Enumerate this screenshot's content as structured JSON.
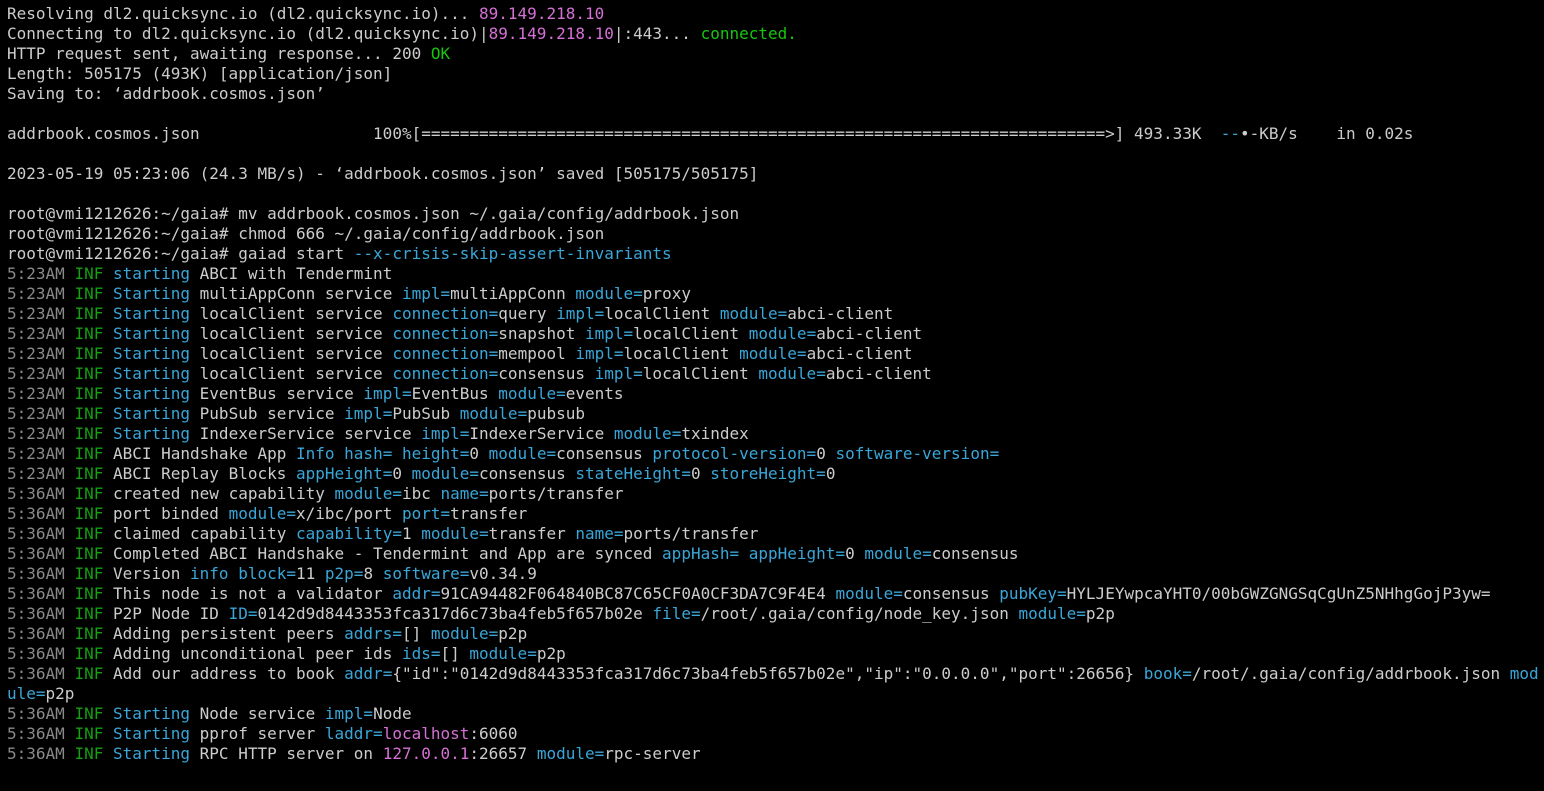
{
  "colors": {
    "default": "#cccccc",
    "cyan": "#3aa6d8",
    "green": "#13a10e",
    "bright-green": "#16c60c",
    "magenta": "#d670d6",
    "gray": "#8a8a8a",
    "blue-dim": "#3b78ff",
    "background": "#000000"
  },
  "lines": [
    {
      "segs": [
        [
          "default",
          "Resolving dl2.quicksync.io (dl2.quicksync.io)... "
        ],
        [
          "magenta",
          "89.149.218.10"
        ]
      ]
    },
    {
      "segs": [
        [
          "default",
          "Connecting to dl2.quicksync.io (dl2.quicksync.io)|"
        ],
        [
          "magenta",
          "89.149.218.10"
        ],
        [
          "default",
          "|:443... "
        ],
        [
          "bright-green",
          "connected."
        ]
      ]
    },
    {
      "segs": [
        [
          "default",
          "HTTP request sent, awaiting response... 200 "
        ],
        [
          "bright-green",
          "OK"
        ]
      ]
    },
    {
      "segs": [
        [
          "default",
          "Length: 505175 (493K) [application/json]"
        ]
      ]
    },
    {
      "segs": [
        [
          "default",
          "Saving to: ‘addrbook.cosmos.json’"
        ]
      ]
    },
    {
      "segs": [
        [
          "default",
          ""
        ]
      ]
    },
    {
      "segs": [
        [
          "default",
          "addrbook.cosmos.json                  100%[=======================================================================>] 493.33K  "
        ],
        [
          "cyan",
          "--"
        ],
        [
          "default",
          "•-KB/s    in 0.02s"
        ]
      ]
    },
    {
      "segs": [
        [
          "default",
          ""
        ]
      ]
    },
    {
      "segs": [
        [
          "default",
          "2023-05-19 05:23:06 (24.3 MB/s) - ‘addrbook.cosmos.json’ saved [505175/505175]"
        ]
      ]
    },
    {
      "segs": [
        [
          "default",
          ""
        ]
      ]
    },
    {
      "segs": [
        [
          "default",
          "root@vmi1212626:~/gaia# mv addrbook.cosmos.json ~/.gaia/config/addrbook.json"
        ]
      ]
    },
    {
      "segs": [
        [
          "default",
          "root@vmi1212626:~/gaia# chmod 666 ~/.gaia/config/addrbook.json"
        ]
      ]
    },
    {
      "segs": [
        [
          "default",
          "root@vmi1212626:~/gaia# gaiad start "
        ],
        [
          "cyan",
          "--x-crisis-skip-assert-invariants"
        ]
      ]
    },
    {
      "segs": [
        [
          "gray",
          "5:23AM "
        ],
        [
          "green",
          "INF "
        ],
        [
          "cyan",
          "starting"
        ],
        [
          "default",
          " ABCI with Tendermint"
        ]
      ]
    },
    {
      "segs": [
        [
          "gray",
          "5:23AM "
        ],
        [
          "green",
          "INF "
        ],
        [
          "cyan",
          "Starting"
        ],
        [
          "default",
          " multiAppConn service "
        ],
        [
          "cyan",
          "impl="
        ],
        [
          "default",
          "multiAppConn "
        ],
        [
          "cyan",
          "module="
        ],
        [
          "default",
          "proxy"
        ]
      ]
    },
    {
      "segs": [
        [
          "gray",
          "5:23AM "
        ],
        [
          "green",
          "INF "
        ],
        [
          "cyan",
          "Starting"
        ],
        [
          "default",
          " localClient service "
        ],
        [
          "cyan",
          "connection="
        ],
        [
          "default",
          "query "
        ],
        [
          "cyan",
          "impl="
        ],
        [
          "default",
          "localClient "
        ],
        [
          "cyan",
          "module="
        ],
        [
          "default",
          "abci-client"
        ]
      ]
    },
    {
      "segs": [
        [
          "gray",
          "5:23AM "
        ],
        [
          "green",
          "INF "
        ],
        [
          "cyan",
          "Starting"
        ],
        [
          "default",
          " localClient service "
        ],
        [
          "cyan",
          "connection="
        ],
        [
          "default",
          "snapshot "
        ],
        [
          "cyan",
          "impl="
        ],
        [
          "default",
          "localClient "
        ],
        [
          "cyan",
          "module="
        ],
        [
          "default",
          "abci-client"
        ]
      ]
    },
    {
      "segs": [
        [
          "gray",
          "5:23AM "
        ],
        [
          "green",
          "INF "
        ],
        [
          "cyan",
          "Starting"
        ],
        [
          "default",
          " localClient service "
        ],
        [
          "cyan",
          "connection="
        ],
        [
          "default",
          "mempool "
        ],
        [
          "cyan",
          "impl="
        ],
        [
          "default",
          "localClient "
        ],
        [
          "cyan",
          "module="
        ],
        [
          "default",
          "abci-client"
        ]
      ]
    },
    {
      "segs": [
        [
          "gray",
          "5:23AM "
        ],
        [
          "green",
          "INF "
        ],
        [
          "cyan",
          "Starting"
        ],
        [
          "default",
          " localClient service "
        ],
        [
          "cyan",
          "connection="
        ],
        [
          "default",
          "consensus "
        ],
        [
          "cyan",
          "impl="
        ],
        [
          "default",
          "localClient "
        ],
        [
          "cyan",
          "module="
        ],
        [
          "default",
          "abci-client"
        ]
      ]
    },
    {
      "segs": [
        [
          "gray",
          "5:23AM "
        ],
        [
          "green",
          "INF "
        ],
        [
          "cyan",
          "Starting"
        ],
        [
          "default",
          " EventBus service "
        ],
        [
          "cyan",
          "impl="
        ],
        [
          "default",
          "EventBus "
        ],
        [
          "cyan",
          "module="
        ],
        [
          "default",
          "events"
        ]
      ]
    },
    {
      "segs": [
        [
          "gray",
          "5:23AM "
        ],
        [
          "green",
          "INF "
        ],
        [
          "cyan",
          "Starting"
        ],
        [
          "default",
          " PubSub service "
        ],
        [
          "cyan",
          "impl="
        ],
        [
          "default",
          "PubSub "
        ],
        [
          "cyan",
          "module="
        ],
        [
          "default",
          "pubsub"
        ]
      ]
    },
    {
      "segs": [
        [
          "gray",
          "5:23AM "
        ],
        [
          "green",
          "INF "
        ],
        [
          "cyan",
          "Starting"
        ],
        [
          "default",
          " IndexerService service "
        ],
        [
          "cyan",
          "impl="
        ],
        [
          "default",
          "IndexerService "
        ],
        [
          "cyan",
          "module="
        ],
        [
          "default",
          "txindex"
        ]
      ]
    },
    {
      "segs": [
        [
          "gray",
          "5:23AM "
        ],
        [
          "green",
          "INF "
        ],
        [
          "default",
          "ABCI Handshake App "
        ],
        [
          "cyan",
          "Info hash= height="
        ],
        [
          "default",
          "0 "
        ],
        [
          "cyan",
          "module="
        ],
        [
          "default",
          "consensus "
        ],
        [
          "cyan",
          "protocol-version="
        ],
        [
          "default",
          "0 "
        ],
        [
          "cyan",
          "software-version="
        ]
      ]
    },
    {
      "segs": [
        [
          "gray",
          "5:23AM "
        ],
        [
          "green",
          "INF "
        ],
        [
          "default",
          "ABCI Replay Blocks "
        ],
        [
          "cyan",
          "appHeight="
        ],
        [
          "default",
          "0 "
        ],
        [
          "cyan",
          "module="
        ],
        [
          "default",
          "consensus "
        ],
        [
          "cyan",
          "stateHeight="
        ],
        [
          "default",
          "0 "
        ],
        [
          "cyan",
          "storeHeight="
        ],
        [
          "default",
          "0"
        ]
      ]
    },
    {
      "segs": [
        [
          "gray",
          "5:36AM "
        ],
        [
          "green",
          "INF "
        ],
        [
          "default",
          "created new capability "
        ],
        [
          "cyan",
          "module="
        ],
        [
          "default",
          "ibc "
        ],
        [
          "cyan",
          "name="
        ],
        [
          "default",
          "ports/transfer"
        ]
      ]
    },
    {
      "segs": [
        [
          "gray",
          "5:36AM "
        ],
        [
          "green",
          "INF "
        ],
        [
          "default",
          "port binded "
        ],
        [
          "cyan",
          "module="
        ],
        [
          "default",
          "x/ibc/port "
        ],
        [
          "cyan",
          "port="
        ],
        [
          "default",
          "transfer"
        ]
      ]
    },
    {
      "segs": [
        [
          "gray",
          "5:36AM "
        ],
        [
          "green",
          "INF "
        ],
        [
          "default",
          "claimed capability "
        ],
        [
          "cyan",
          "capability="
        ],
        [
          "default",
          "1 "
        ],
        [
          "cyan",
          "module="
        ],
        [
          "default",
          "transfer "
        ],
        [
          "cyan",
          "name="
        ],
        [
          "default",
          "ports/transfer"
        ]
      ]
    },
    {
      "segs": [
        [
          "gray",
          "5:36AM "
        ],
        [
          "green",
          "INF "
        ],
        [
          "default",
          "Completed ABCI Handshake - Tendermint and App are synced "
        ],
        [
          "cyan",
          "appHash= appHeight="
        ],
        [
          "default",
          "0 "
        ],
        [
          "cyan",
          "module="
        ],
        [
          "default",
          "consensus"
        ]
      ]
    },
    {
      "segs": [
        [
          "gray",
          "5:36AM "
        ],
        [
          "green",
          "INF "
        ],
        [
          "default",
          "Version "
        ],
        [
          "cyan",
          "info block="
        ],
        [
          "default",
          "11 "
        ],
        [
          "cyan",
          "p2p="
        ],
        [
          "default",
          "8 "
        ],
        [
          "cyan",
          "software="
        ],
        [
          "default",
          "v0.34.9"
        ]
      ]
    },
    {
      "wrap": true,
      "segs": [
        [
          "gray",
          "5:36AM "
        ],
        [
          "green",
          "INF "
        ],
        [
          "default",
          "This node is not a validator "
        ],
        [
          "cyan",
          "addr="
        ],
        [
          "default",
          "91CA94482F064840BC87C65CF0A0CF3DA7C9F4E4 "
        ],
        [
          "cyan",
          "module="
        ],
        [
          "default",
          "consensus "
        ],
        [
          "cyan",
          "pubKey="
        ],
        [
          "default",
          "HYLJEYwpcaYHT0/00bGWZGNGSqCgUnZ5NHhgGojP3yw="
        ]
      ]
    },
    {
      "segs": [
        [
          "gray",
          "5:36AM "
        ],
        [
          "green",
          "INF "
        ],
        [
          "default",
          "P2P Node ID "
        ],
        [
          "cyan",
          "ID="
        ],
        [
          "default",
          "0142d9d8443353fca317d6c73ba4feb5f657b02e "
        ],
        [
          "cyan",
          "file="
        ],
        [
          "default",
          "/root/.gaia/config/node_key.json "
        ],
        [
          "cyan",
          "module="
        ],
        [
          "default",
          "p2p"
        ]
      ]
    },
    {
      "segs": [
        [
          "gray",
          "5:36AM "
        ],
        [
          "green",
          "INF "
        ],
        [
          "default",
          "Adding persistent peers "
        ],
        [
          "cyan",
          "addrs="
        ],
        [
          "default",
          "[] "
        ],
        [
          "cyan",
          "module="
        ],
        [
          "default",
          "p2p"
        ]
      ]
    },
    {
      "segs": [
        [
          "gray",
          "5:36AM "
        ],
        [
          "green",
          "INF "
        ],
        [
          "default",
          "Adding unconditional peer ids "
        ],
        [
          "cyan",
          "ids="
        ],
        [
          "default",
          "[] "
        ],
        [
          "cyan",
          "module="
        ],
        [
          "default",
          "p2p"
        ]
      ]
    },
    {
      "wrap": true,
      "segs": [
        [
          "gray",
          "5:36AM "
        ],
        [
          "green",
          "INF "
        ],
        [
          "default",
          "Add our address to book "
        ],
        [
          "cyan",
          "addr="
        ],
        [
          "default",
          "{\"id\":\"0142d9d8443353fca317d6c73ba4feb5f657b02e\",\"ip\":\"0.0.0.0\",\"port\":26656} "
        ],
        [
          "cyan",
          "book="
        ],
        [
          "default",
          "/root/.gaia/config/addrbook.json "
        ],
        [
          "cyan",
          "module="
        ],
        [
          "default",
          "p2p"
        ]
      ]
    },
    {
      "segs": [
        [
          "gray",
          "5:36AM "
        ],
        [
          "green",
          "INF "
        ],
        [
          "cyan",
          "Starting"
        ],
        [
          "default",
          " Node service "
        ],
        [
          "cyan",
          "impl="
        ],
        [
          "default",
          "Node"
        ]
      ]
    },
    {
      "segs": [
        [
          "gray",
          "5:36AM "
        ],
        [
          "green",
          "INF "
        ],
        [
          "cyan",
          "Starting"
        ],
        [
          "default",
          " pprof server "
        ],
        [
          "cyan",
          "laddr="
        ],
        [
          "magenta",
          "localhost"
        ],
        [
          "default",
          ":6060"
        ]
      ]
    },
    {
      "segs": [
        [
          "gray",
          "5:36AM "
        ],
        [
          "green",
          "INF "
        ],
        [
          "cyan",
          "Starting"
        ],
        [
          "default",
          " RPC HTTP server on "
        ],
        [
          "magenta",
          "127.0.0.1"
        ],
        [
          "default",
          ":26657 "
        ],
        [
          "cyan",
          "module="
        ],
        [
          "default",
          "rpc-server"
        ]
      ]
    }
  ]
}
